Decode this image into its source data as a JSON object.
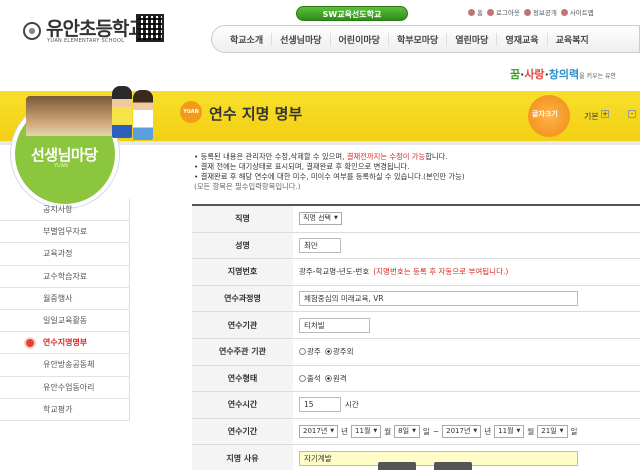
{
  "header": {
    "school_name": "유안초등학교",
    "school_name_en": "YUAN ELEMENTARY SCHOOL",
    "sw_button": "SW교육선도학교",
    "top_links": [
      "홈",
      "로그아웃",
      "정보공개",
      "사이트맵"
    ],
    "gnb": [
      "학교소개",
      "선생님마당",
      "어린이마당",
      "학부모마당",
      "열린마당",
      "영재교육",
      "교육복지"
    ],
    "slogan": {
      "part1": "꿈",
      "sep1": "·",
      "part2": "사랑",
      "sep2": "·",
      "part3": "창의력",
      "tail": "을 키우는 유안"
    }
  },
  "left": {
    "title": "선생님마당",
    "sub": "YUAN",
    "menu": [
      {
        "label": "공지사항",
        "active": false
      },
      {
        "label": "부별업무자료",
        "active": false
      },
      {
        "label": "교육과정",
        "active": false
      },
      {
        "label": "교수학습자료",
        "active": false
      },
      {
        "label": "월중행사",
        "active": false
      },
      {
        "label": "일일교육활동",
        "active": false
      },
      {
        "label": "연수지명명부",
        "active": true
      },
      {
        "label": "유안방송공동체",
        "active": false
      },
      {
        "label": "유안수업동아리",
        "active": false
      },
      {
        "label": "학교평가",
        "active": false
      }
    ]
  },
  "page": {
    "badge": "YUAN",
    "title": "연수 지명 명부",
    "fontsize_label": "글자크기",
    "basic": "기본",
    "plus": "+",
    "minus": "-"
  },
  "notice": {
    "line1_a": "• 등록된 내용은 관리자만 수정,삭제할 수 있으며, ",
    "line1_red": "결재전까지는 수정이 가능",
    "line1_b": "합니다.",
    "line2": "• 결재 전에는 대기상태로 표시되며, 결재완료 후 확인으로 변경됩니다.",
    "line3": "• 결재완료 후 해당 연수에 대한 미수, 미이수 여부를 등록하실 수 있습니다.(본인만 가능)",
    "line4": "(모든 항목은 필수입력항목입니다.)"
  },
  "form": {
    "rows": {
      "position": {
        "label": "직명",
        "select": "직명 선택"
      },
      "name": {
        "label": "성명",
        "value": "최만"
      },
      "appoint_no": {
        "label": "지명번호",
        "format": "광주-학교명-년도-번호",
        "note": "(지명번호는 등록 후 자동으로 부여됩니다.)"
      },
      "course": {
        "label": "연수과정명",
        "value": "체험중심의 미래교육, VR"
      },
      "org": {
        "label": "연수기관",
        "value": "티처빌"
      },
      "host": {
        "label": "연수주관 기관",
        "opt1": "광주",
        "opt2": "광주외",
        "selected": "광주외"
      },
      "mode": {
        "label": "연수형태",
        "opt1": "출석",
        "opt2": "원격",
        "selected": "원격"
      },
      "hours": {
        "label": "연수시간",
        "value": "15",
        "unit": "시간"
      },
      "period": {
        "label": "연수기간",
        "start_year": "2017년",
        "start_month": "11월",
        "start_day": "8일",
        "end_year": "2017년",
        "end_month": "11월",
        "end_day": "21일",
        "u_year": "년",
        "u_month": "월",
        "u_day": "일",
        "tilde": "~"
      },
      "reason": {
        "label": "지명 사유",
        "value": "자기계발"
      }
    }
  },
  "colors": {
    "band": "#f3cf14",
    "green": "#8cc63f",
    "accent_red": "#d6281f"
  }
}
